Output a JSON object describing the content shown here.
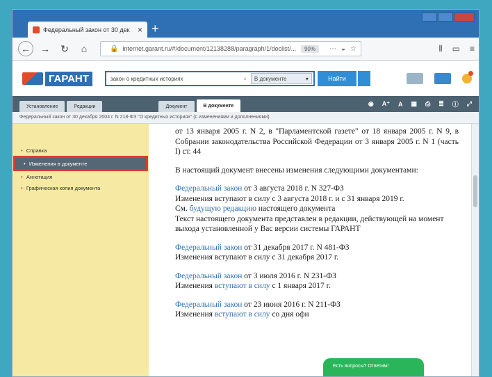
{
  "browser": {
    "tab_title": "Федеральный закон от 30 дек",
    "tab_close": "×",
    "new_tab": "+",
    "url": "internet.garant.ru/#/document/12138288/paragraph/1/doclist/...",
    "zoom": "90%",
    "nav_icons": [
      "back-icon",
      "forward-icon",
      "reload-icon",
      "home-icon"
    ]
  },
  "garant": {
    "logo_text": "ГАРАНТ",
    "search_value": "закон о кредитных историях",
    "search_clear": "×",
    "scope_label": "В документе",
    "find_button": "Найти"
  },
  "doc_tabs": {
    "left": [
      "Установление",
      "Редакции"
    ],
    "right": [
      "Документ",
      "В документе"
    ],
    "active": "В документе",
    "tools": [
      "A⁺",
      "A"
    ]
  },
  "breadcrumb": "Федеральный закон от 30 декабря 2004 г. N 218-ФЗ \"О кредитных историях\" (с изменениями и дополнениями)",
  "sidebar": {
    "items": [
      {
        "label": "Справка",
        "active": false
      },
      {
        "label": "Изменения в документе",
        "active": true
      },
      {
        "label": "Аннотация",
        "active": false
      },
      {
        "label": "Графическая копия документа",
        "active": false
      }
    ]
  },
  "content": {
    "intro": "от 13 января 2005 г. N 2, в \"Парламентской газете\" от 18 января 2005 г. N 9, в Собрании законодательства Российской Федерации от 3 января 2005 г. N 1 (часть I) ст. 44",
    "lead": "В настоящий документ внесены изменения следующими документами:",
    "changes": [
      {
        "link": "Федеральный закон",
        "rest": " от 3 августа 2018 г. N 327-ФЗ",
        "line2": "Изменения вступают в силу с 3 августа 2018 г. и с 31 января 2019 г.",
        "extra_pre": "См. ",
        "extra_link": "будущую редакцию",
        "extra_post": " настоящего документа",
        "note": "Текст настоящего документа представлен в редакции, действующей на момент выхода установленной у Вас версии системы ГАРАНТ"
      },
      {
        "link": "Федеральный закон",
        "rest": " от 31 декабря 2017 г. N 481-ФЗ",
        "line2": "Изменения вступают в силу с 31 декабря 2017 г."
      },
      {
        "link": "Федеральный закон",
        "rest": " от 3 июля 2016 г. N 231-ФЗ",
        "line2_pre": "Изменения ",
        "line2_link": "вступают в силу",
        "line2_post": " с 1 января 2017 г."
      },
      {
        "link": "Федеральный закон",
        "rest": " от 23 июня 2016 г. N 211-ФЗ",
        "line2_pre": "Изменения ",
        "line2_link": "вступают в силу",
        "line2_post": " со дня офи"
      }
    ]
  },
  "chat": {
    "label": "Есть вопросы? Ответим!"
  },
  "colors": {
    "accent": "#2f6fb3",
    "sidebar_bg": "#f6e9a4",
    "highlight": "#e23a2f",
    "chat": "#2bb55a"
  }
}
